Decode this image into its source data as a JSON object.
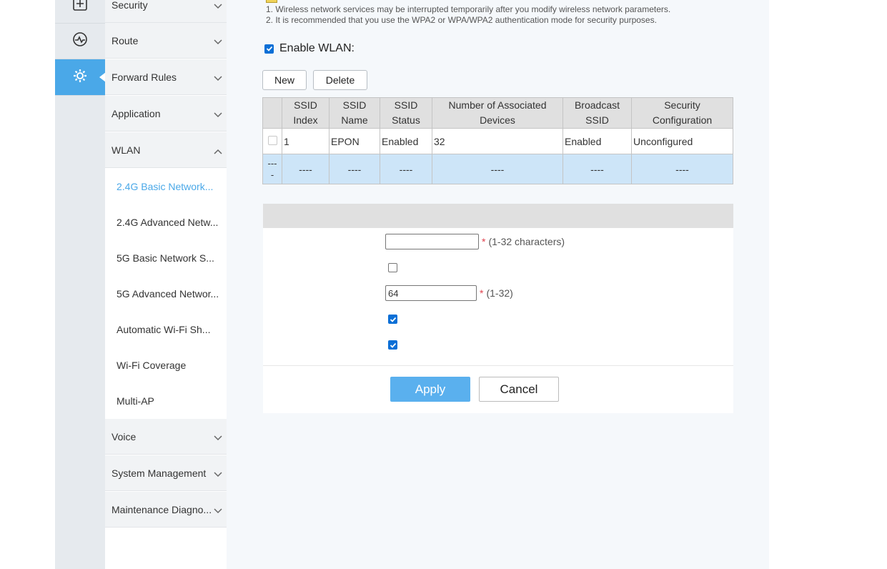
{
  "rail": {
    "icons": [
      "plus-box-icon",
      "pulse-icon",
      "gear-icon"
    ],
    "active": 2
  },
  "menu": {
    "security": "Security",
    "route": "Route",
    "forward_rules": "Forward Rules",
    "application": "Application",
    "wlan": "WLAN",
    "voice": "Voice",
    "system_management": "System Management",
    "maintenance": "Maintenance Diagno...",
    "wlan_sub": [
      "2.4G Basic Network...",
      "2.4G Advanced Netw...",
      "5G Basic Network S...",
      "5G Advanced Networ...",
      "Automatic Wi-Fi Sh...",
      "Wi-Fi Coverage",
      "Multi-AP"
    ]
  },
  "notes": {
    "line1": "1. Wireless network services may be interrupted temporarily after you modify wireless network parameters.",
    "line2": "2. It is recommended that you use the WPA2 or WPA/WPA2 authentication mode for security purposes."
  },
  "enable_wlan": {
    "label": "Enable WLAN:",
    "checked": true
  },
  "buttons": {
    "new": "New",
    "delete": "Delete",
    "apply": "Apply",
    "cancel": "Cancel"
  },
  "table": {
    "headers": {
      "ssid_index": [
        "SSID",
        "Index"
      ],
      "ssid_name": [
        "SSID",
        "Name"
      ],
      "ssid_status": [
        "SSID",
        "Status"
      ],
      "devices": [
        "Number of Associated",
        "Devices"
      ],
      "broadcast": [
        "Broadcast",
        "SSID"
      ],
      "security": [
        "Security",
        "Configuration"
      ]
    },
    "row": {
      "index": "1",
      "name": "EPON",
      "status": "Enabled",
      "devices": "32",
      "broadcast": "Enabled",
      "security": "Unconfigured"
    },
    "blank": {
      "first_top": "---",
      "first_bottom": "-",
      "cell": "----"
    }
  },
  "form": {
    "ssid_name_value": "",
    "ssid_name_hint": "(1-32 characters)",
    "devices_value": "64",
    "devices_hint": "(1-32)",
    "star": "*"
  },
  "colors": {
    "accent": "#4aa8e8",
    "apply": "#5ab0ee",
    "row_highlight": "#cde5f8"
  }
}
